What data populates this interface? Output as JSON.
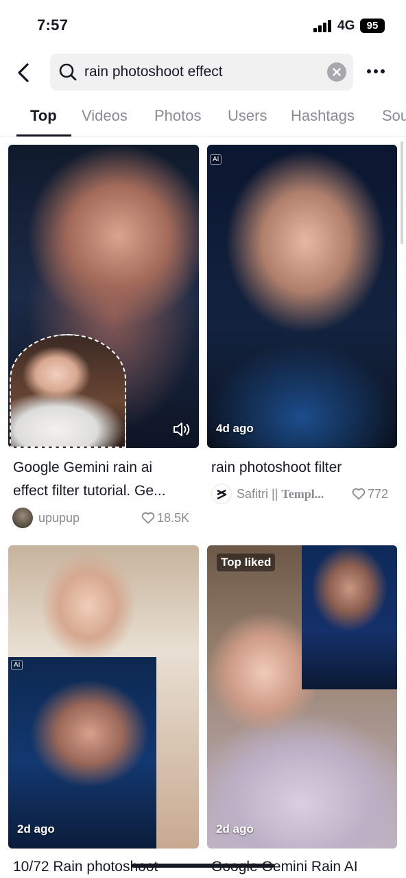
{
  "status_bar": {
    "time": "7:57",
    "network": "4G",
    "battery": "95"
  },
  "search": {
    "query": "rain photoshoot effect"
  },
  "tabs": [
    {
      "label": "Top",
      "active": true
    },
    {
      "label": "Videos"
    },
    {
      "label": "Photos"
    },
    {
      "label": "Users"
    },
    {
      "label": "Hashtags"
    },
    {
      "label": "Sou"
    }
  ],
  "results": [
    {
      "title_line1": "Google Gemini rain ai",
      "title_line2": "effect filter tutorial.  Ge...",
      "author": "upupup",
      "likes": "18.5K",
      "sound_icon": "speaker-icon"
    },
    {
      "ai_badge": "AI",
      "time_label": "4d ago",
      "title_line1": "rain photoshoot filter",
      "author_prefix": "Safitri || ",
      "author_suffix": "Templ...",
      "likes": "772"
    },
    {
      "ai_badge": "AI",
      "time_label": "2d ago",
      "title_line1": "10/72 Rain photoshoot"
    },
    {
      "badge": "Top liked",
      "time_label": "2d ago",
      "title_line1": "Google Gemini Rain AI"
    }
  ],
  "colors": {
    "text": "#161823",
    "muted": "#8a8b91",
    "search_bg": "#f1f1f2"
  }
}
